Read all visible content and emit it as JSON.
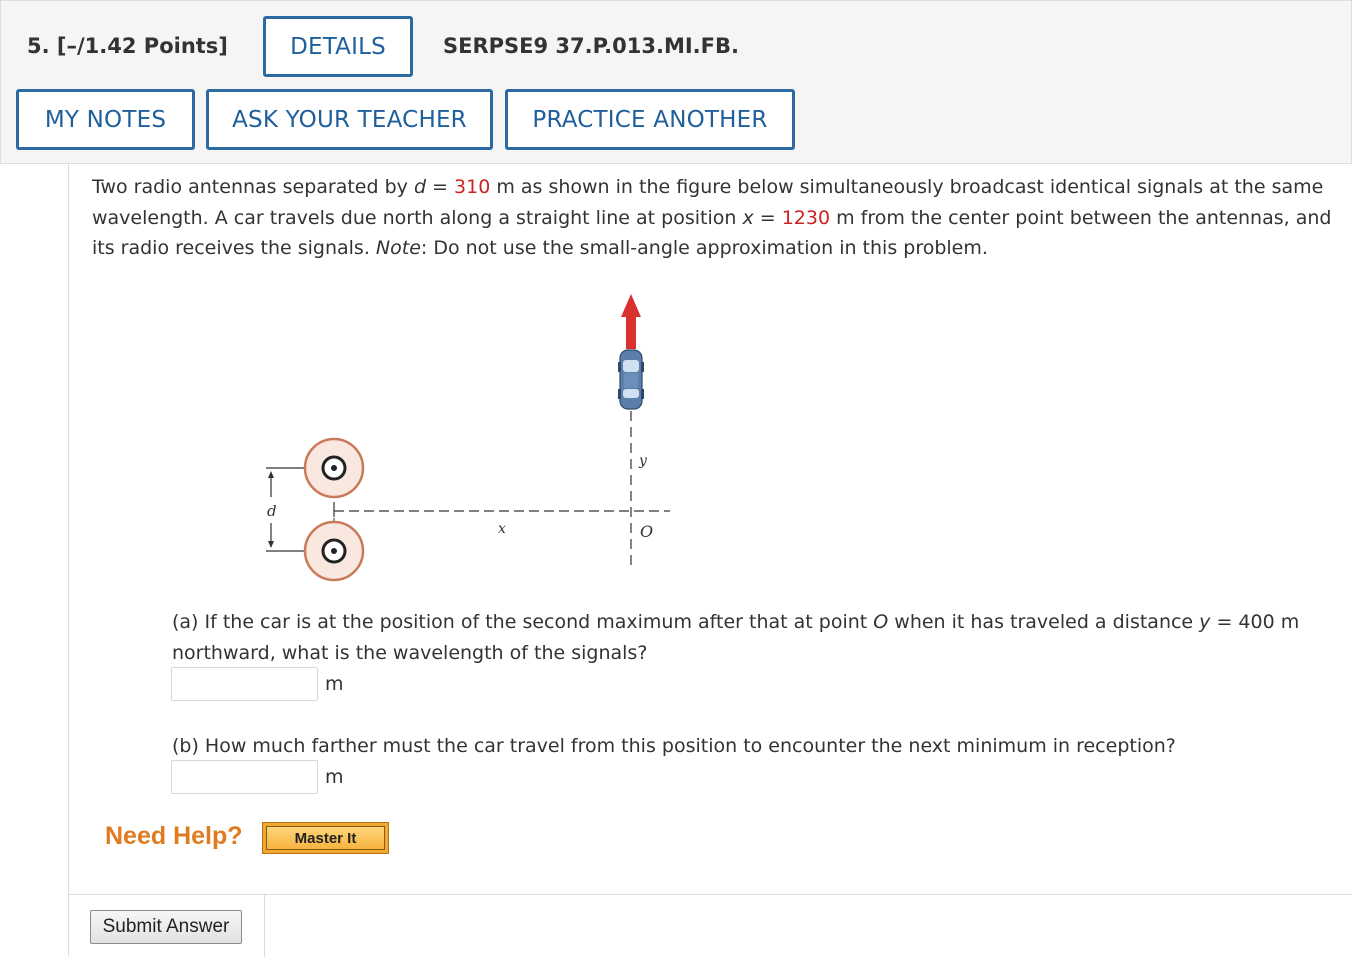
{
  "header": {
    "question_number": "5.",
    "points": "[–/1.42 Points]",
    "details_button": "DETAILS",
    "question_id": "SERPSE9 37.P.013.MI.FB.",
    "my_notes_button": "MY NOTES",
    "ask_teacher_button": "ASK YOUR TEACHER",
    "practice_button": "PRACTICE ANOTHER"
  },
  "problem": {
    "t1": "Two radio antennas separated by ",
    "var_d": "d",
    "eq1": " = ",
    "d_value": "310",
    "t2": " m as shown in the figure below simultaneously broadcast identical signals at the same wavelength. A car travels due north along a straight line at position ",
    "var_x": "x",
    "eq2": " = ",
    "x_value": "1230",
    "t3": " m from the center point between the antennas, and its radio receives the signals. ",
    "note_label": "Note",
    "t4": ": Do not use the small-angle approximation in this problem."
  },
  "figure": {
    "label_d": "d",
    "label_x": "x",
    "label_y": "y",
    "label_o": "O"
  },
  "part_a": {
    "t1": "(a) If the car is at the position of the second maximum after that at point ",
    "var_o": "O",
    "t2": " when it has traveled a distance ",
    "var_y": "y",
    "t3": " = 400 m northward, what is the wavelength of the signals?",
    "input_value": "",
    "unit": "m"
  },
  "part_b": {
    "text": "(b) How much farther must the car travel from this position to encounter the next minimum in reception?",
    "input_value": "",
    "unit": "m"
  },
  "help": {
    "label": "Need Help?",
    "master_it": "Master It"
  },
  "submit": {
    "label": "Submit Answer"
  },
  "colors": {
    "link_blue": "#1f5f9c",
    "value_red": "#cc2222",
    "help_orange": "#e07b20",
    "arrow_red": "#d93030",
    "antenna_ring": "#c97a5a"
  }
}
